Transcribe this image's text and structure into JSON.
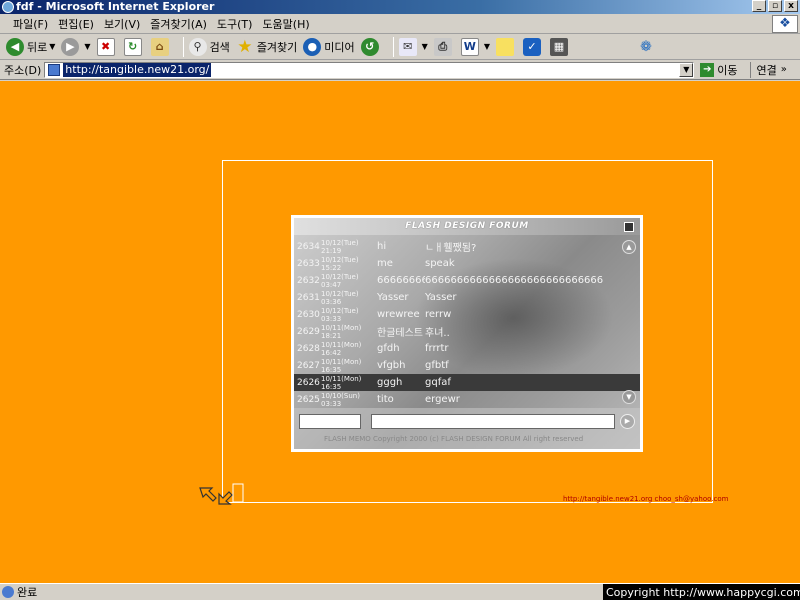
{
  "window": {
    "title": "fdf - Microsoft Internet Explorer",
    "min_btn": "_",
    "max_btn": "▫",
    "close_btn": "x"
  },
  "menu": [
    "파일(F)",
    "편집(E)",
    "보기(V)",
    "즐겨찾기(A)",
    "도구(T)",
    "도움말(H)"
  ],
  "toolbar": {
    "back": "뒤로",
    "search": "검색",
    "favorites": "즐겨찾기",
    "media": "미디어"
  },
  "address": {
    "label": "주소(D)",
    "url": "http://tangible.new21.org/",
    "go": "이동",
    "links": "연결"
  },
  "forum": {
    "title": "FLASH DESIGN FORUM",
    "copyright": "FLASH MEMO  Copyright 2000 (c) FLASH DESIGN FORUM All right reserved",
    "entries": [
      {
        "num": "2634",
        "date": "10/12(Tue) 21:19",
        "name": "hi",
        "msg": "ㄴㅐ휄쨌됨?"
      },
      {
        "num": "2633",
        "date": "10/12(Tue) 15:22",
        "name": "me",
        "msg": "speak"
      },
      {
        "num": "2632",
        "date": "10/12(Tue) 03:47",
        "name": "66666666",
        "msg": "6666666666666666666666666666"
      },
      {
        "num": "2631",
        "date": "10/12(Tue) 03:36",
        "name": "Yasser",
        "msg": "Yasser"
      },
      {
        "num": "2630",
        "date": "10/12(Tue) 03:33",
        "name": "wrewree",
        "msg": "rerrw"
      },
      {
        "num": "2629",
        "date": "10/11(Mon) 18:21",
        "name": "한글테스트",
        "msg": "후녀.."
      },
      {
        "num": "2628",
        "date": "10/11(Mon) 16:42",
        "name": "gfdh",
        "msg": "frrrtr"
      },
      {
        "num": "2627",
        "date": "10/11(Mon) 16:35",
        "name": "vfgbh",
        "msg": "gfbtf"
      },
      {
        "num": "2626",
        "date": "10/11(Mon) 16:35",
        "name": "gggh",
        "msg": "gqfaf"
      },
      {
        "num": "2625",
        "date": "10/10(Sun) 03:33",
        "name": "tito",
        "msg": "ergewr"
      }
    ],
    "selected_index": 8
  },
  "page": {
    "footer_link": "http://tangible.new21.org  choo_sh@yahoo.com"
  },
  "status": {
    "text": "완료",
    "copyright": "Copyright  http://www.happycgi.com"
  },
  "colors": {
    "page_bg": "#ff9900",
    "title_bar": "#0a246a"
  }
}
